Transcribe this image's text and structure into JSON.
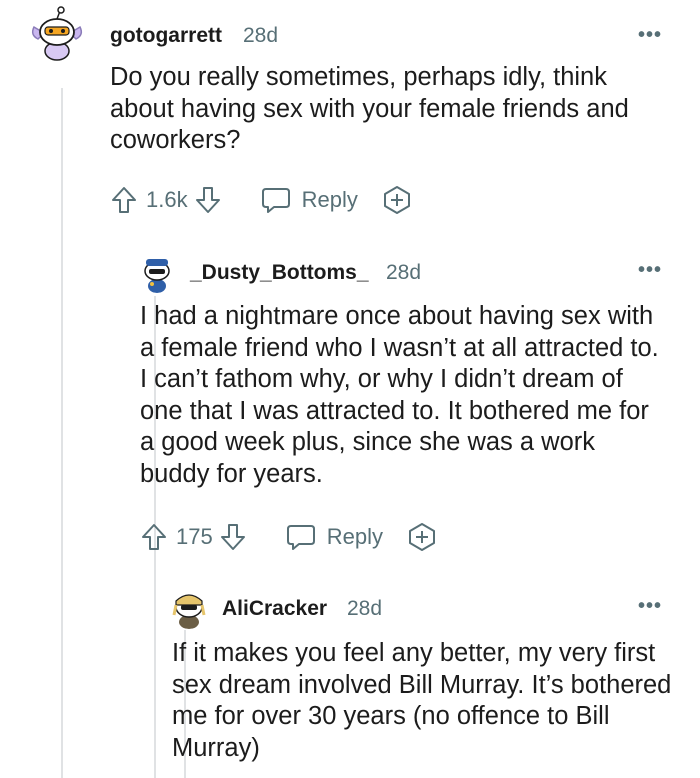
{
  "comments": [
    {
      "author": "gotogarrett",
      "age": "28d",
      "more": "•••",
      "body": "Do you really sometimes, perhaps idly, think about having sex with your female friends and coworkers?",
      "votes": "1.6k",
      "reply_label": "Reply"
    },
    {
      "author": "_Dusty_Bottoms_",
      "age": "28d",
      "more": "•••",
      "body": "I had a nightmare once about having sex with a female friend who I wasn’t at all attracted to. I can’t fathom why, or why I didn’t dream of one that I was attracted to. It bothered me for a good week plus, since she was a work buddy for years.",
      "votes": "175",
      "reply_label": "Reply"
    },
    {
      "author": "AliCracker",
      "age": "28d",
      "more": "•••",
      "body": "If it makes you feel any better, my very first sex dream involved Bill Murray. It’s bothered me for over 30 years (no offence to Bill Murray)"
    }
  ],
  "colors": {
    "text": "#1c1c1c",
    "muted": "#576f76",
    "thread": "#e0e2e4"
  },
  "icons": [
    "upvote-icon",
    "downvote-icon",
    "reply-icon",
    "award-icon",
    "more-options-icon"
  ]
}
